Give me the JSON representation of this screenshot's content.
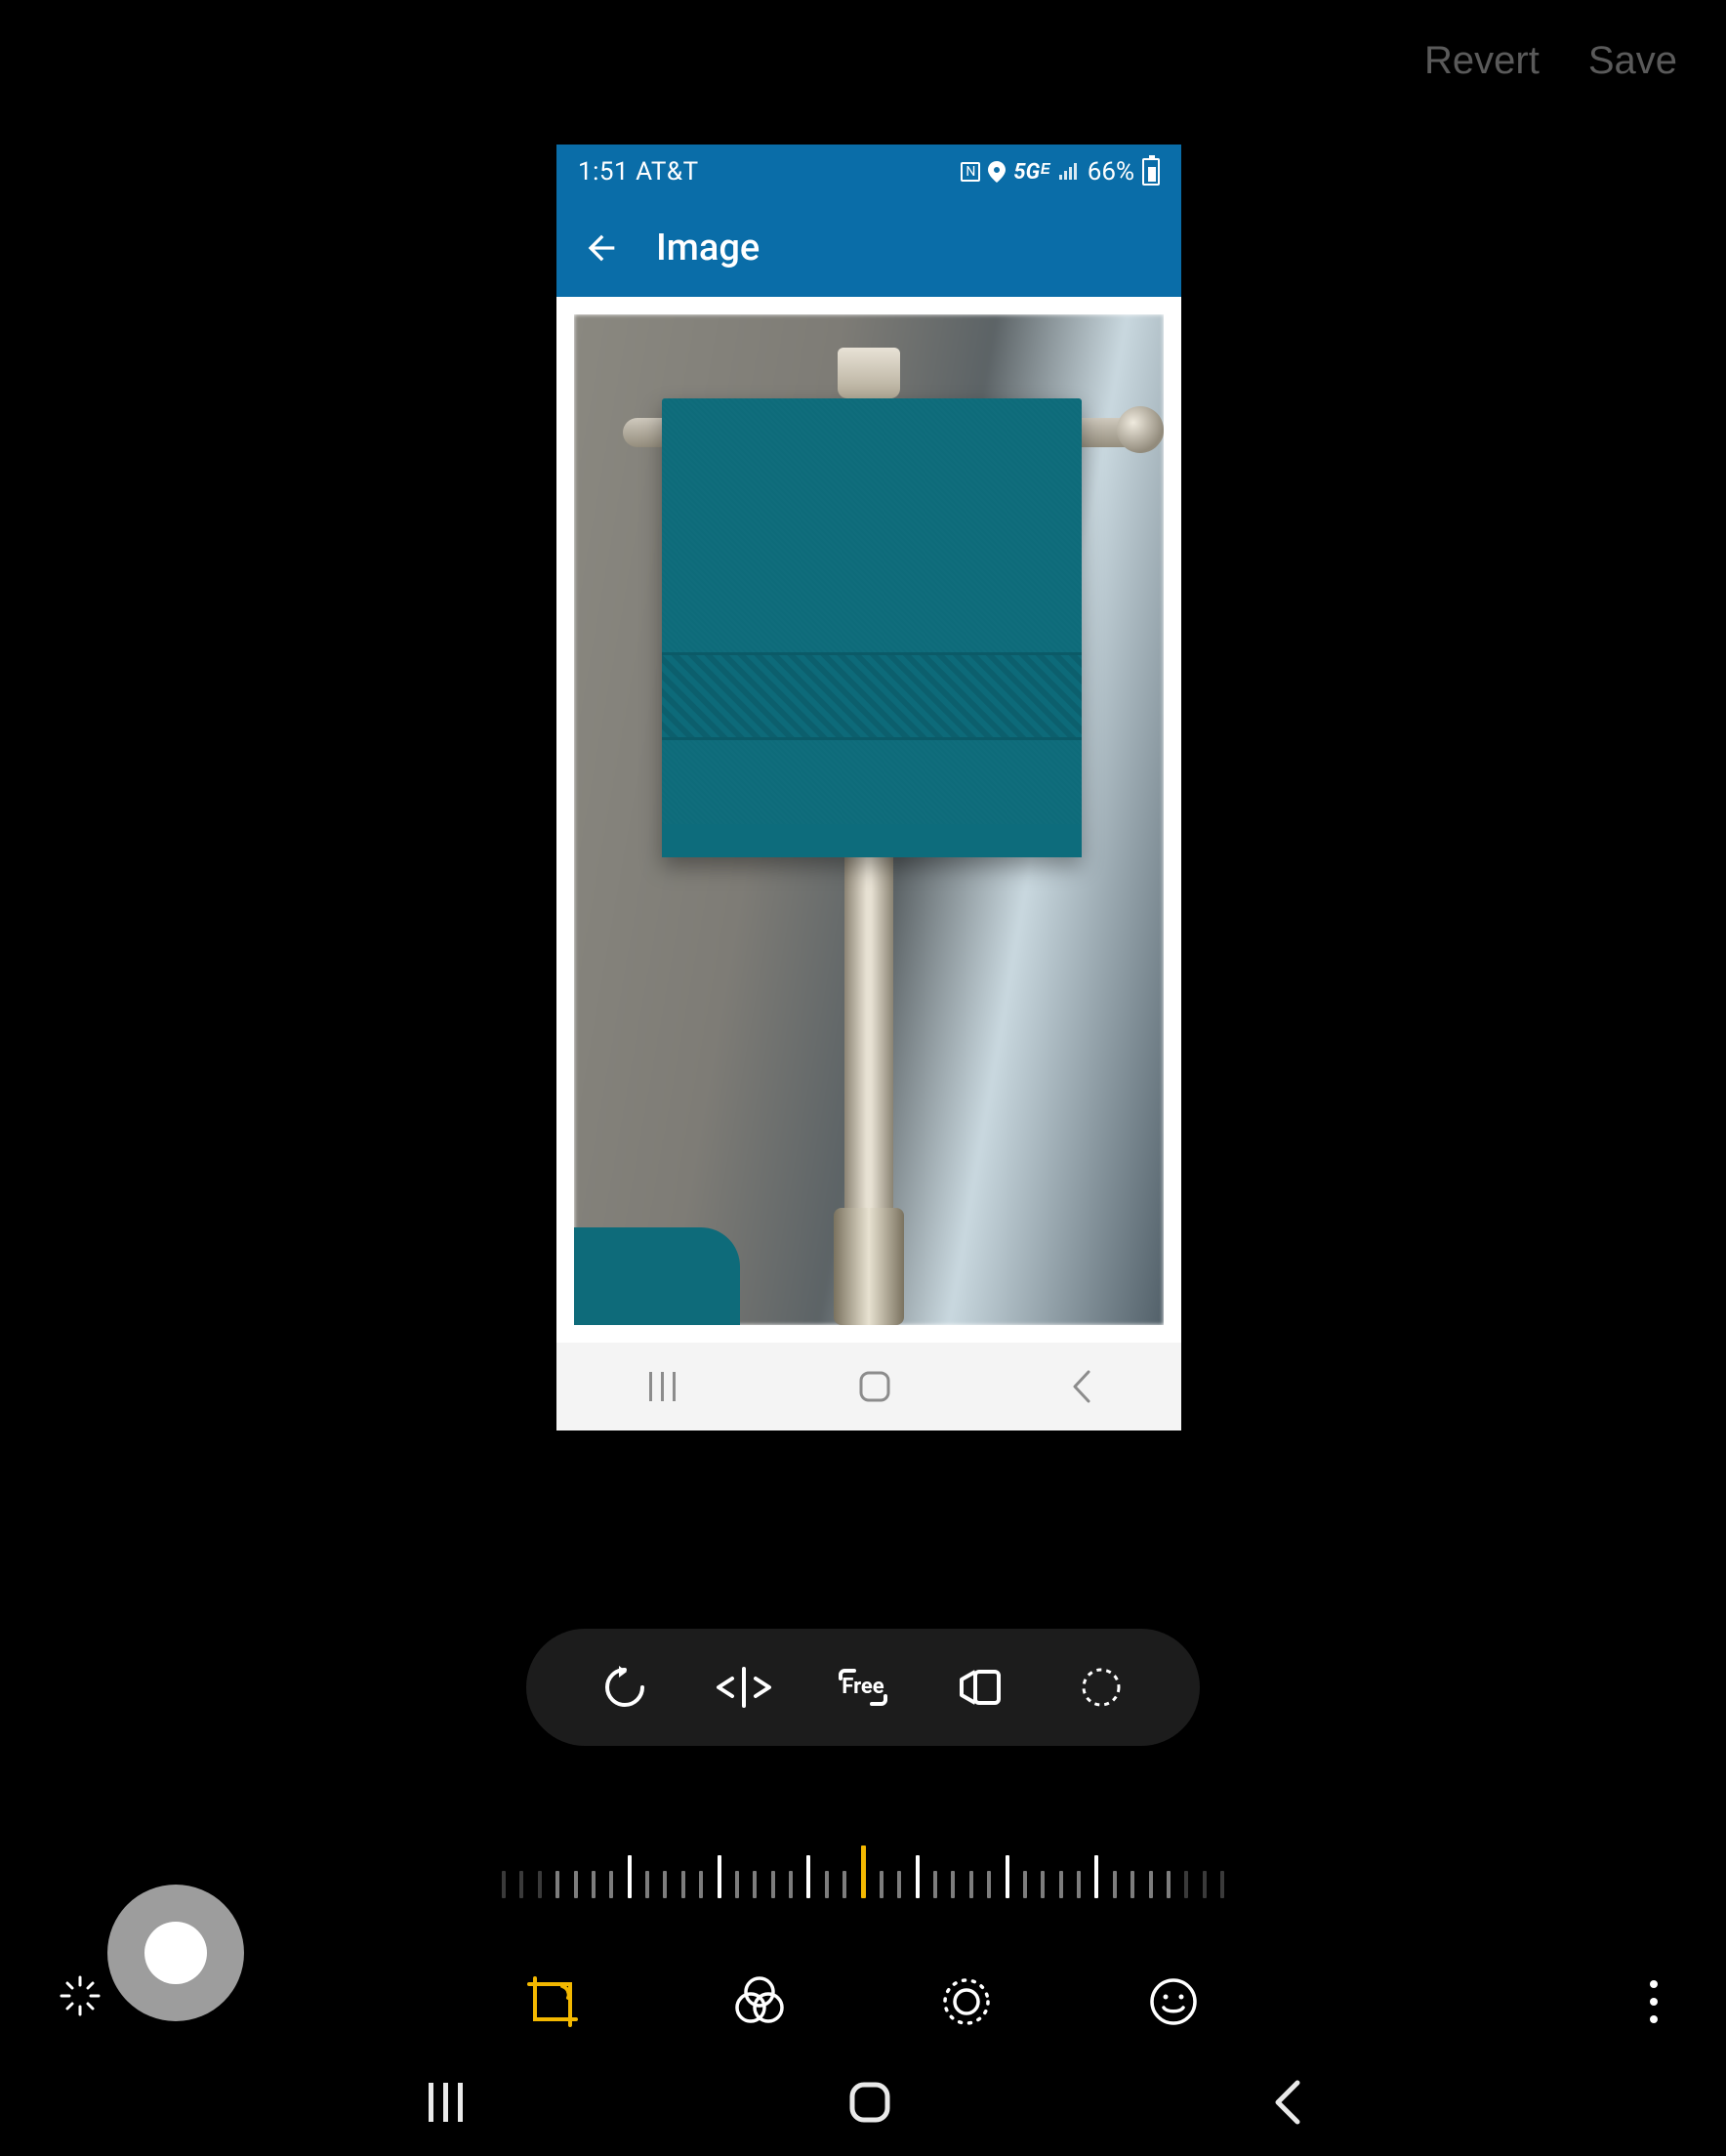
{
  "editor": {
    "revert_label": "Revert",
    "save_label": "Save"
  },
  "inner_app": {
    "status_time": "1:51 AT&T",
    "status_network": "5Gᴱ",
    "status_battery": "66%",
    "title": "Image"
  },
  "crop_tools": {
    "rotate": "rotate",
    "flip": "flip",
    "ratio_label": "Free",
    "perspective": "perspective",
    "shape": "shape-mask"
  },
  "ruler": {
    "ticks_left_edge": 3,
    "ticks_main_each_side": 15
  },
  "modes": {
    "transform": "transform",
    "filters": "filters",
    "adjust": "adjust",
    "stickers": "stickers"
  }
}
